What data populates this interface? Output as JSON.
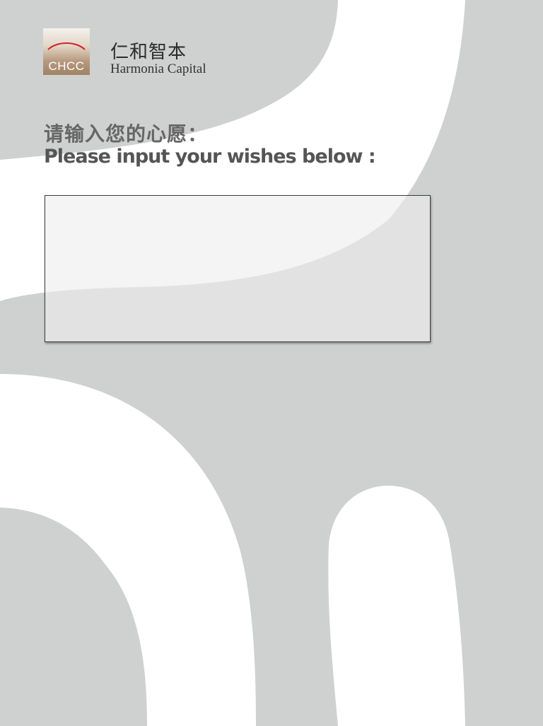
{
  "theme": {
    "background": "#cfd0d0",
    "shape_fill": "#ffffff",
    "logo_arc": "#d1232a"
  },
  "logo": {
    "icon": "chcc-logo-icon",
    "abbr": "CHCC"
  },
  "brand": {
    "name_cn": "仁和智本",
    "name_en": "Harmonia Capital"
  },
  "prompt": {
    "cn": "请输入您的心愿：",
    "en": "Please input your wishes below :"
  },
  "wish_input": {
    "value": "",
    "placeholder": ""
  }
}
